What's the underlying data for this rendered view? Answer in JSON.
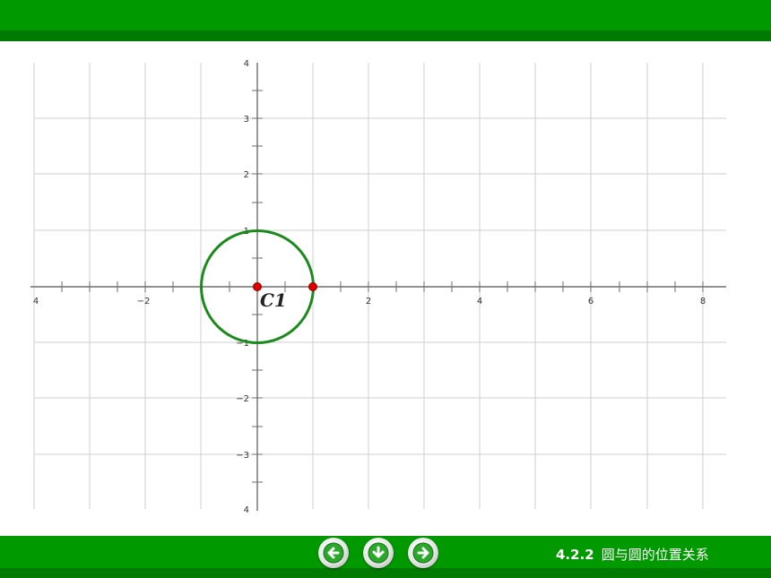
{
  "graph": {
    "x_ticks": [
      "4",
      "−2",
      "2",
      "4",
      "6",
      "8"
    ],
    "y_ticks": [
      "4",
      "3",
      "2",
      "1",
      "−1",
      "−2",
      "−3",
      "4"
    ],
    "circle_label": "C1",
    "circle": {
      "center": [
        0,
        0
      ],
      "radius": 1
    },
    "points": [
      [
        0,
        0
      ],
      [
        1,
        0
      ]
    ],
    "colors": {
      "circle": "#1a8a1a",
      "point": "#dd0000",
      "grid": "#cfcfcf"
    }
  },
  "footer": {
    "section": "4.2.2",
    "title": "圆与圆的位置关系"
  },
  "nav": {
    "icons": [
      "arrow-left-icon",
      "arrow-down-icon",
      "arrow-right-icon"
    ]
  },
  "theme": {
    "bar": "#009a00",
    "bar_dark": "#007a00"
  }
}
